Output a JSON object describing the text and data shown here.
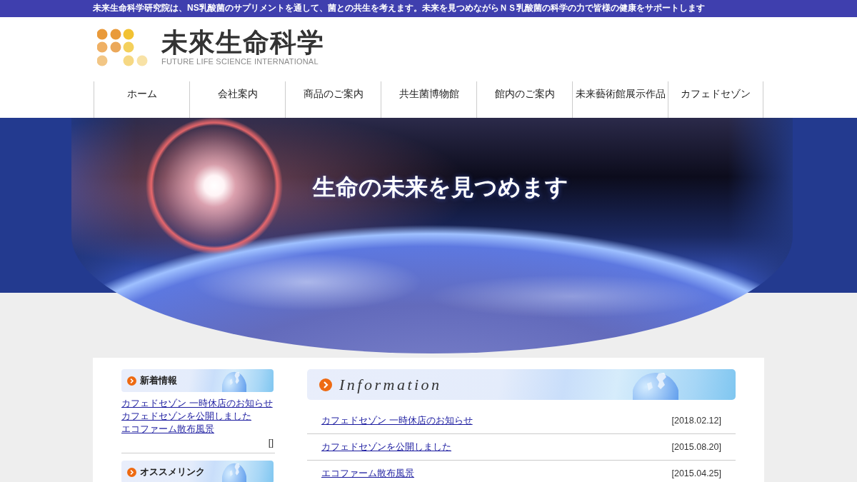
{
  "top_bar": {
    "text": "未来生命科学研究院は、NS乳酸菌のサプリメントを通して、菌との共生を考えます。未来を見つめながらＮＳ乳酸菌の科学の力で皆様の健康をサポートします"
  },
  "header": {
    "logo_title": "未來生命科学",
    "logo_subtitle": "FUTURE LIFE SCIENCE INTERNATIONAL"
  },
  "nav": {
    "items": [
      {
        "label": "ホーム"
      },
      {
        "label": "会社案内"
      },
      {
        "label": "商品のご案内"
      },
      {
        "label": "共生菌博物館"
      },
      {
        "label": "館内のご案内"
      },
      {
        "label": "未来藝術館展示作品"
      },
      {
        "label": "カフェドセゾン"
      }
    ]
  },
  "hero": {
    "tagline": "生命の未来を見つめます"
  },
  "sidebar": {
    "sections": [
      {
        "title": "新着情報",
        "links": [
          "カフェドセゾン 一時休店のお知らせ",
          "カフェドセゾンを公開しました",
          "エコファーム散布風景"
        ],
        "footer": "[]"
      },
      {
        "title": "オススメリンク"
      }
    ]
  },
  "information": {
    "title": "Information",
    "rows": [
      {
        "title": "カフェドセゾン 一時休店のお知らせ",
        "date": "[2018.02.12]"
      },
      {
        "title": "カフェドセゾンを公開しました",
        "date": "[2015.08.20]"
      },
      {
        "title": "エコファーム散布風景",
        "date": "[2015.04.25]"
      }
    ]
  }
}
